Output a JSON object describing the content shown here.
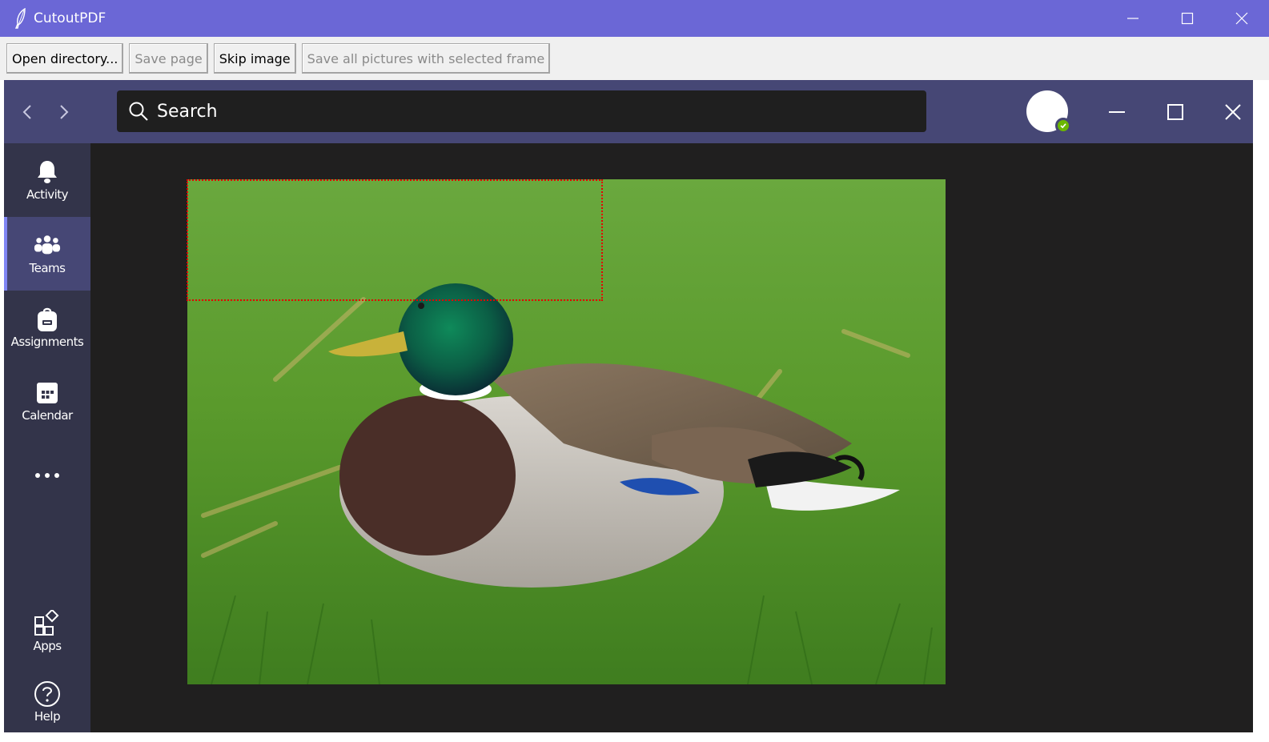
{
  "window": {
    "title": "CutoutPDF",
    "title_color": "#6b67d6"
  },
  "toolbar": {
    "open_directory": "Open directory...",
    "save_page": "Save page",
    "skip_image": "Skip image",
    "save_all": "Save all pictures with selected frame"
  },
  "teams": {
    "header_color": "#464775",
    "search_placeholder": "Search",
    "rail": [
      {
        "label": "Activity",
        "icon": "bell-icon"
      },
      {
        "label": "Teams",
        "icon": "teams-icon",
        "active": true
      },
      {
        "label": "Assignments",
        "icon": "backpack-icon"
      },
      {
        "label": "Calendar",
        "icon": "calendar-icon"
      },
      {
        "label": "",
        "icon": "more-icon"
      },
      {
        "label": "Apps",
        "icon": "apps-icon"
      },
      {
        "label": "Help",
        "icon": "help-icon"
      }
    ]
  },
  "selection_frame": {
    "color": "#e60000"
  }
}
